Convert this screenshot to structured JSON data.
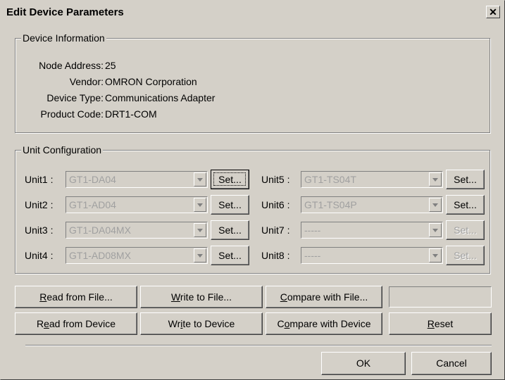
{
  "window": {
    "title": "Edit Device Parameters",
    "close_glyph": "✕"
  },
  "device_info": {
    "legend": "Device Information",
    "rows": [
      {
        "label": "Node Address:",
        "value": "25"
      },
      {
        "label": "Vendor:",
        "value": "OMRON Corporation"
      },
      {
        "label": "Device Type:",
        "value": "Communications Adapter"
      },
      {
        "label": "Product Code:",
        "value": "DRT1-COM"
      }
    ]
  },
  "unit_config": {
    "legend": "Unit Configuration",
    "units": [
      {
        "label": "Unit1 :",
        "value": "GT1-DA04",
        "set": "Set...",
        "set_enabled": true,
        "focused": true
      },
      {
        "label": "Unit2 :",
        "value": "GT1-AD04",
        "set": "Set...",
        "set_enabled": true
      },
      {
        "label": "Unit3 :",
        "value": "GT1-DA04MX",
        "set": "Set...",
        "set_enabled": true
      },
      {
        "label": "Unit4 :",
        "value": "GT1-AD08MX",
        "set": "Set...",
        "set_enabled": true
      },
      {
        "label": "Unit5 :",
        "value": "GT1-TS04T",
        "set": "Set...",
        "set_enabled": true
      },
      {
        "label": "Unit6 :",
        "value": "GT1-TS04P",
        "set": "Set...",
        "set_enabled": true
      },
      {
        "label": "Unit7 :",
        "value": "-----",
        "set": "Set...",
        "set_enabled": false
      },
      {
        "label": "Unit8 :",
        "value": "-----",
        "set": "Set...",
        "set_enabled": false
      }
    ]
  },
  "actions": {
    "read_file": {
      "mn": "R",
      "rest": "ead from File..."
    },
    "write_file": {
      "mn": "W",
      "rest": "rite to File..."
    },
    "compare_file": {
      "mn": "C",
      "rest": "ompare with File..."
    },
    "read_device": {
      "pre": "R",
      "mn": "e",
      "rest": "ad from Device"
    },
    "write_device": {
      "pre": "Wr",
      "mn": "i",
      "rest": "te to Device"
    },
    "compare_device": {
      "pre": "C",
      "mn": "o",
      "rest": "mpare with Device"
    },
    "reset": {
      "mn": "R",
      "rest": "eset"
    }
  },
  "footer": {
    "ok": "OK",
    "cancel": "Cancel"
  }
}
